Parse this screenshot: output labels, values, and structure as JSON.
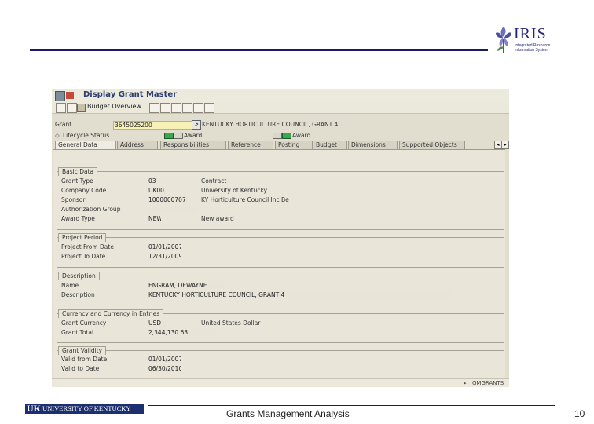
{
  "header": {
    "logo_name": "IRIS",
    "logo_tag_line1": "Integrated Resource",
    "logo_tag_line2": "Information System"
  },
  "sap": {
    "title": "Display Grant Master",
    "toolbar": {
      "budget_overview": "Budget Overview"
    },
    "grant": {
      "label": "Grant",
      "value": "3645025200",
      "description": "KENTUCKY HORTICULTURE COUNCIL, GRANT 4"
    },
    "status": {
      "lifecycle_label": "Lifecycle Status",
      "award1": "Award",
      "award2": "Award",
      "colors": {
        "active": "#3aa84f",
        "inactive": "#d9d6cc"
      }
    },
    "tabs": [
      {
        "label": "General Data",
        "active": true
      },
      {
        "label": "Address"
      },
      {
        "label": "Responsibilities"
      },
      {
        "label": "Reference"
      },
      {
        "label": "Posting"
      },
      {
        "label": "Budget"
      },
      {
        "label": "Dimensions"
      },
      {
        "label": "Supported Objects"
      }
    ],
    "basic_data": {
      "title": "Basic Data",
      "grant_type_label": "Grant Type",
      "grant_type_value": "03",
      "grant_type_desc": "Contract",
      "company_code_label": "Company Code",
      "company_code_value": "UK00",
      "company_code_desc": "University of Kentucky",
      "sponsor_label": "Sponsor",
      "sponsor_value": "1000000707",
      "sponsor_desc": "KY Horticulture Council Inc Be",
      "auth_group_label": "Authorization Group",
      "auth_group_value": "",
      "award_type_label": "Award Type",
      "award_type_value": "NEW",
      "award_type_desc": "New award"
    },
    "project_period": {
      "title": "Project Period",
      "from_label": "Project From Date",
      "from_value": "01/01/2007",
      "to_label": "Project To Date",
      "to_value": "12/31/2009"
    },
    "description": {
      "title": "Description",
      "name_label": "Name",
      "name_value": "ENGRAM, DEWAYNE",
      "desc_label": "Description",
      "desc_value": "KENTUCKY HORTICULTURE COUNCIL, GRANT 4"
    },
    "currency": {
      "title": "Currency and Currency in Entries",
      "grant_currency_label": "Grant Currency",
      "grant_currency_value": "USD",
      "grant_currency_desc": "United States Dollar",
      "grant_total_label": "Grant Total",
      "grant_total_value": "2,344,130.63"
    },
    "validity": {
      "title": "Grant Validity",
      "valid_from_label": "Valid from Date",
      "valid_from_value": "01/01/2007",
      "valid_to_label": "Valid to Date",
      "valid_to_value": "06/30/2010"
    },
    "status_bar": "GMGRANTS"
  },
  "footer": {
    "university": "UNIVERSITY OF KENTUCKY",
    "university_mark": "UK",
    "title": "Grants Management Analysis",
    "page": "10"
  }
}
